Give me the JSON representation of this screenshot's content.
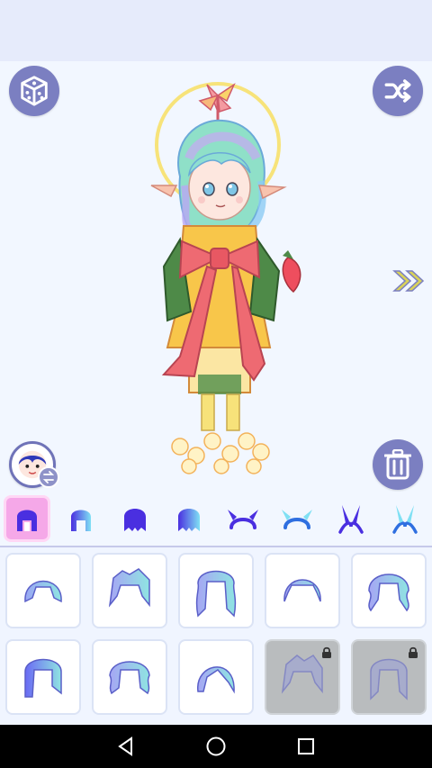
{
  "app": {
    "screen": "hair-style-editor"
  },
  "colors": {
    "accent": "#7b7fc1",
    "tab_active": "#f5a8e8",
    "tab_icon": "#5b3ee6",
    "locked_cell": "#b9bcbe"
  },
  "toolbar": {
    "dice_icon": "dice-icon",
    "shuffle_icon": "shuffle-icon",
    "trash_icon": "trash-icon",
    "avatar_icon": "avatar-icon",
    "next_icon": "double-chevron-right-icon"
  },
  "tabs": [
    {
      "icon": "hair-front-icon",
      "active": true
    },
    {
      "icon": "hair-front-gradient-icon",
      "active": false
    },
    {
      "icon": "hair-back-icon",
      "active": false
    },
    {
      "icon": "hair-back-gradient-icon",
      "active": false
    },
    {
      "icon": "horns-icon",
      "active": false
    },
    {
      "icon": "horns-gradient-icon",
      "active": false
    },
    {
      "icon": "bunny-ears-icon",
      "active": false
    },
    {
      "icon": "bunny-ears-gradient-icon",
      "active": false
    }
  ],
  "items": [
    {
      "icon": "hairstyle-bob-icon",
      "locked": false
    },
    {
      "icon": "hairstyle-messy-icon",
      "locked": false
    },
    {
      "icon": "hairstyle-long-wavy-icon",
      "locked": false
    },
    {
      "icon": "hairstyle-short-icon",
      "locked": false
    },
    {
      "icon": "hairstyle-curly-icon",
      "locked": false
    },
    {
      "icon": "hairstyle-blunt-bob-icon",
      "locked": false
    },
    {
      "icon": "hairstyle-wavy-icon",
      "locked": false
    },
    {
      "icon": "hairstyle-side-part-icon",
      "locked": false
    },
    {
      "icon": "hairstyle-spiky-icon",
      "locked": true
    },
    {
      "icon": "hairstyle-long-icon",
      "locked": true
    }
  ],
  "navbar": {
    "back_icon": "back-icon",
    "home_icon": "home-icon",
    "recents_icon": "recents-icon"
  }
}
